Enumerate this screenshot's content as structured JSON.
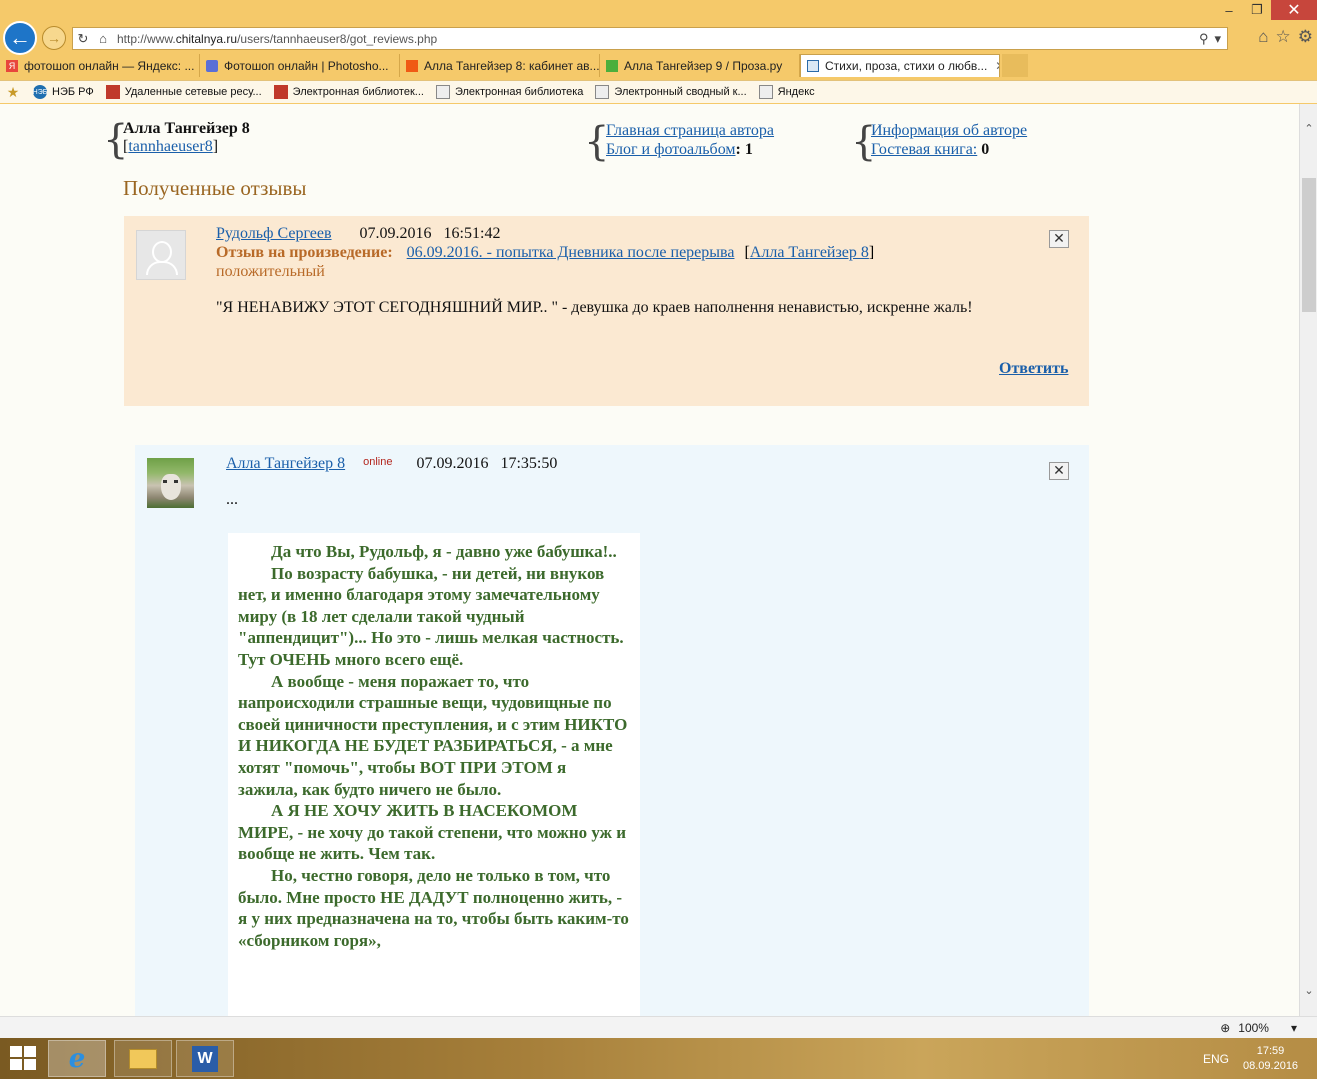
{
  "browser": {
    "address": "http://www.chitalnya.ru/users/tannhaeuser8/got_reviews.php",
    "address_host": "chitalnya.ru",
    "address_pre": "http://www.",
    "address_post": "/users/tannhaeuser8/got_reviews.php",
    "tabs": [
      {
        "label": "фотошоп онлайн — Яндекс: ..."
      },
      {
        "label": "Фотошоп онлайн | Photosho..."
      },
      {
        "label": "Алла Тангейзер 8: кабинет ав..."
      },
      {
        "label": "Алла Тангейзер 9 / Проза.ру"
      },
      {
        "label": "Стихи, проза, стихи о любв..."
      }
    ],
    "favorites": [
      {
        "label": "НЭБ РФ"
      },
      {
        "label": "Удаленные сетевые ресу..."
      },
      {
        "label": "Электронная библиотек..."
      },
      {
        "label": "Электронная библиотека"
      },
      {
        "label": "Электронный сводный к..."
      },
      {
        "label": "Яндекс"
      }
    ],
    "zoom": "100%"
  },
  "author": {
    "name": "Алла Тангейзер 8",
    "login_open": "[",
    "login": "tannhaeuser8",
    "login_close": "]",
    "nav": {
      "main_page": "Главная страница автора",
      "blog": "Блог и фотоальбом",
      "blog_count": ": 1",
      "info": "Информация об авторе",
      "guestbook": "Гостевая книга:",
      "guestbook_count": " 0"
    }
  },
  "section_title": "Полученные отзывы",
  "review": {
    "author": "Рудольф Сергеев",
    "date": "07.09.2016",
    "time": "16:51:42",
    "work_label": "Отзыв на произведение:",
    "work_title": "06.09.2016. - попытка Дневника после перерыва",
    "work_author_open": "[",
    "work_author": "Алла Тангейзер 8",
    "work_author_close": "]",
    "type": "положительный",
    "text": "\"Я НЕНАВИЖУ ЭТОТ СЕГОДНЯШНИЙ МИР.. \" - девушка до краев наполнення ненавистью, искренне жаль!",
    "reply_label": "Ответить",
    "close_label": "✕"
  },
  "answer": {
    "author": "Алла Тангейзер 8",
    "status": "online",
    "date": "07.09.2016",
    "time": "17:35:50",
    "intro": "...",
    "close_label": "✕",
    "paragraphs": [
      "Да что Вы, Рудольф, я - давно уже бабушка!..",
      "По возрасту бабушка, - ни детей, ни внуков нет, и именно благодаря этому замечательному миру (в 18 лет сделали такой чудный \"аппендицит\")... Но это - лишь мелкая частность. Тут ОЧЕНЬ много всего ещё.",
      "А вообще - меня поражает то, что напроисходили страшные вещи, чудовищные по своей циничности преступления, и с этим НИКТО И НИКОГДА НЕ БУДЕТ РАЗБИРАТЬСЯ, - а мне хотят \"помочь\", чтобы ВОТ ПРИ ЭТОМ я зажила, как будто ничего не было.",
      "А Я НЕ ХОЧУ ЖИТЬ В НАСЕКОМОМ МИРЕ, - не хочу до такой степени, что можно уж и вообще не жить. Чем так.",
      "Но, честно говоря, дело не только в том, что было. Мне просто НЕ ДАДУТ полноценно жить, - я у них предназначена на то, чтобы быть каким-то «сборником горя»,"
    ]
  },
  "taskbar": {
    "lang": "ENG",
    "time": "17:59",
    "date": "08.09.2016"
  },
  "colors": {
    "chrome": "#f5c96a",
    "review_bg": "#fbe9d2",
    "answer_bg": "#eef7fc",
    "link": "#1a5faa",
    "section_title": "#9a6622",
    "answer_text": "#3c6a2c"
  }
}
